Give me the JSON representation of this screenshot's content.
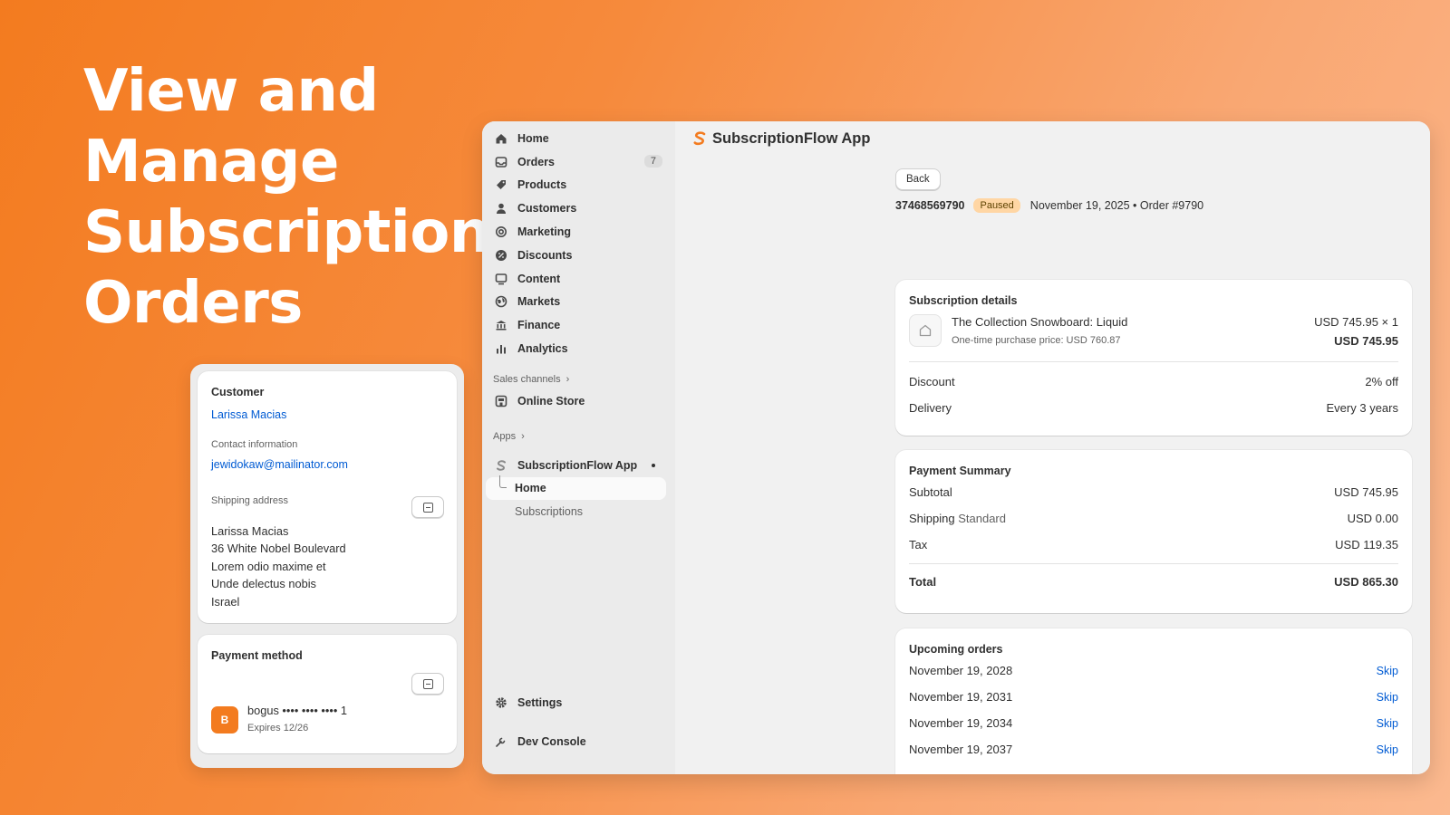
{
  "hero": {
    "title": "View and Manage Subscription Orders"
  },
  "customer_card": {
    "title": "Customer",
    "customer_name": "Larissa Macias",
    "contact_label": "Contact information",
    "email": "jewidokaw@mailinator.com",
    "shipping_label": "Shipping address",
    "address_lines": [
      "Larissa Macias",
      "36 White Nobel Boulevard",
      "Lorem odio maxime et",
      "Unde delectus nobis",
      "Israel"
    ]
  },
  "payment_card": {
    "title": "Payment method",
    "card_initial": "B",
    "card_text": "bogus •••• •••• •••• 1",
    "expires": "Expires 12/26"
  },
  "sidebar": {
    "items": [
      {
        "label": "Home",
        "icon": "home-icon"
      },
      {
        "label": "Orders",
        "icon": "orders-icon",
        "badge": "7"
      },
      {
        "label": "Products",
        "icon": "tag-icon"
      },
      {
        "label": "Customers",
        "icon": "person-icon"
      },
      {
        "label": "Marketing",
        "icon": "target-icon"
      },
      {
        "label": "Discounts",
        "icon": "discount-icon"
      },
      {
        "label": "Content",
        "icon": "content-icon"
      },
      {
        "label": "Markets",
        "icon": "globe-icon"
      },
      {
        "label": "Finance",
        "icon": "bank-icon"
      },
      {
        "label": "Analytics",
        "icon": "bar-chart-icon"
      }
    ],
    "sales_channels_label": "Sales channels",
    "online_store_label": "Online Store",
    "apps_label": "Apps",
    "app_name": "SubscriptionFlow App",
    "app_sub_items": [
      "Home",
      "Subscriptions"
    ],
    "settings_label": "Settings",
    "dev_console_label": "Dev Console"
  },
  "header": {
    "app_title": "SubscriptionFlow App"
  },
  "order": {
    "back_label": "Back",
    "id": "37468569790",
    "status": "Paused",
    "meta": "November 19, 2025 • Order #9790"
  },
  "subscription_details": {
    "title": "Subscription details",
    "product_name": "The Collection Snowboard: Liquid",
    "one_time_price": "One-time purchase price: USD 760.87",
    "unit_price": "USD 745.95 × 1",
    "line_total": "USD 745.95",
    "discount_label": "Discount",
    "discount_value": "2% off",
    "delivery_label": "Delivery",
    "delivery_value": "Every 3 years"
  },
  "payment_summary": {
    "title": "Payment Summary",
    "subtotal_label": "Subtotal",
    "subtotal_value": "USD 745.95",
    "shipping_label": "Shipping",
    "shipping_method": "Standard",
    "shipping_value": "USD 0.00",
    "tax_label": "Tax",
    "tax_value": "USD 119.35",
    "total_label": "Total",
    "total_value": "USD 865.30"
  },
  "upcoming_orders": {
    "title": "Upcoming orders",
    "skip_label": "Skip",
    "dates": [
      "November 19, 2028",
      "November 19, 2031",
      "November 19, 2034",
      "November 19, 2037"
    ]
  },
  "colors": {
    "accent": "#f37b1f",
    "link": "#005bd3",
    "paused_badge": "#ffd6a4"
  }
}
